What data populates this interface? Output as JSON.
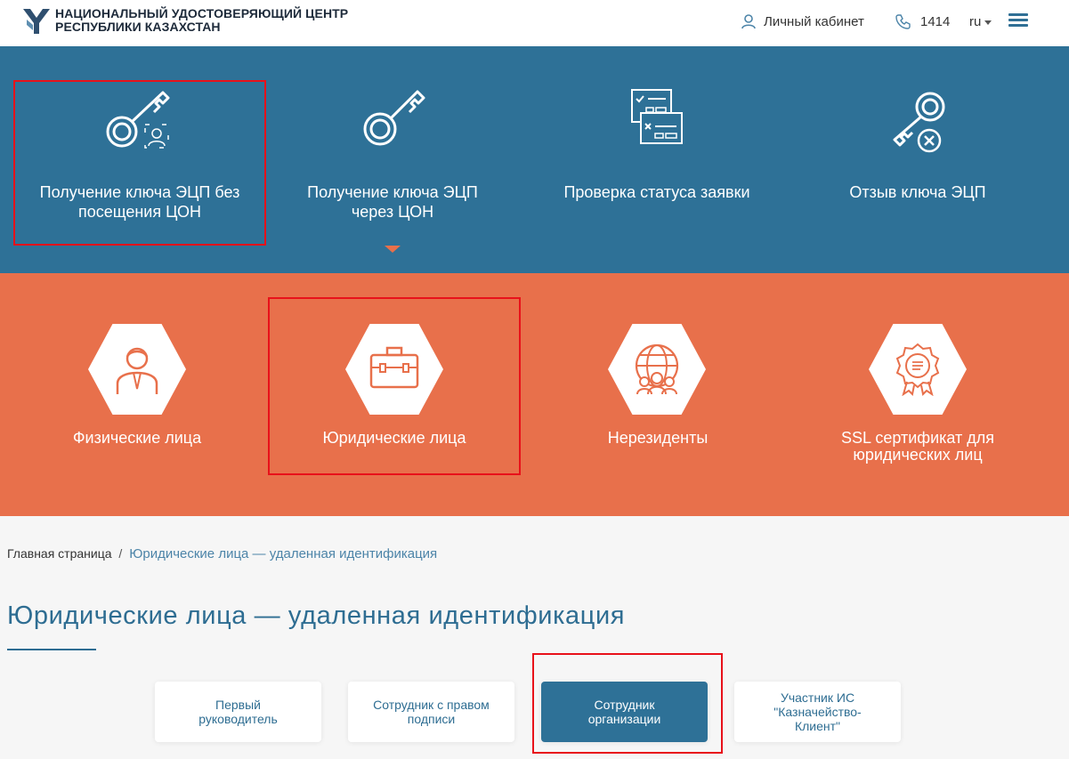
{
  "header": {
    "logo_line1": "НАЦИОНАЛЬНЫЙ УДОСТОВЕРЯЮЩИЙ ЦЕНТР",
    "logo_line2": "РЕСПУБЛИКИ КАЗАХСТАН",
    "cabinet_label": "Личный кабинет",
    "phone": "1414",
    "lang": "ru"
  },
  "services": [
    {
      "label_line1": "Получение ключа ЭЦП без",
      "label_line2": "посещения ЦОН",
      "icon": "key-face-icon"
    },
    {
      "label_line1": "Получение ключа ЭЦП",
      "label_line2": "через ЦОН",
      "icon": "key-icon"
    },
    {
      "label_line1": "Проверка статуса заявки",
      "label_line2": "",
      "icon": "forms-check-icon"
    },
    {
      "label_line1": "Отзыв ключа ЭЦП",
      "label_line2": "",
      "icon": "key-revoke-icon"
    }
  ],
  "categories": [
    {
      "label_line1": "Физические лица",
      "label_line2": "",
      "icon": "person-icon"
    },
    {
      "label_line1": "Юридические лица",
      "label_line2": "",
      "icon": "briefcase-icon"
    },
    {
      "label_line1": "Нерезиденты",
      "label_line2": "",
      "icon": "globe-people-icon"
    },
    {
      "label_line1": "SSL сертификат для",
      "label_line2": "юридических лиц",
      "icon": "certificate-icon"
    }
  ],
  "breadcrumb": {
    "home": "Главная страница",
    "separator": "/",
    "current": "Юридические лица — удаленная идентификация"
  },
  "page_title": "Юридические лица — удаленная идентификация",
  "options": [
    {
      "line1": "Первый",
      "line2": "руководитель"
    },
    {
      "line1": "Сотрудник с правом",
      "line2": "подписи"
    },
    {
      "line1": "Сотрудник",
      "line2": "организации"
    },
    {
      "line1": "Участник ИС",
      "line2": "\"Казначейство-",
      "line3": "Клиент\""
    }
  ],
  "colors": {
    "primary_blue": "#2e7197",
    "accent_orange": "#e8704b",
    "highlight_red": "#e8111a"
  }
}
